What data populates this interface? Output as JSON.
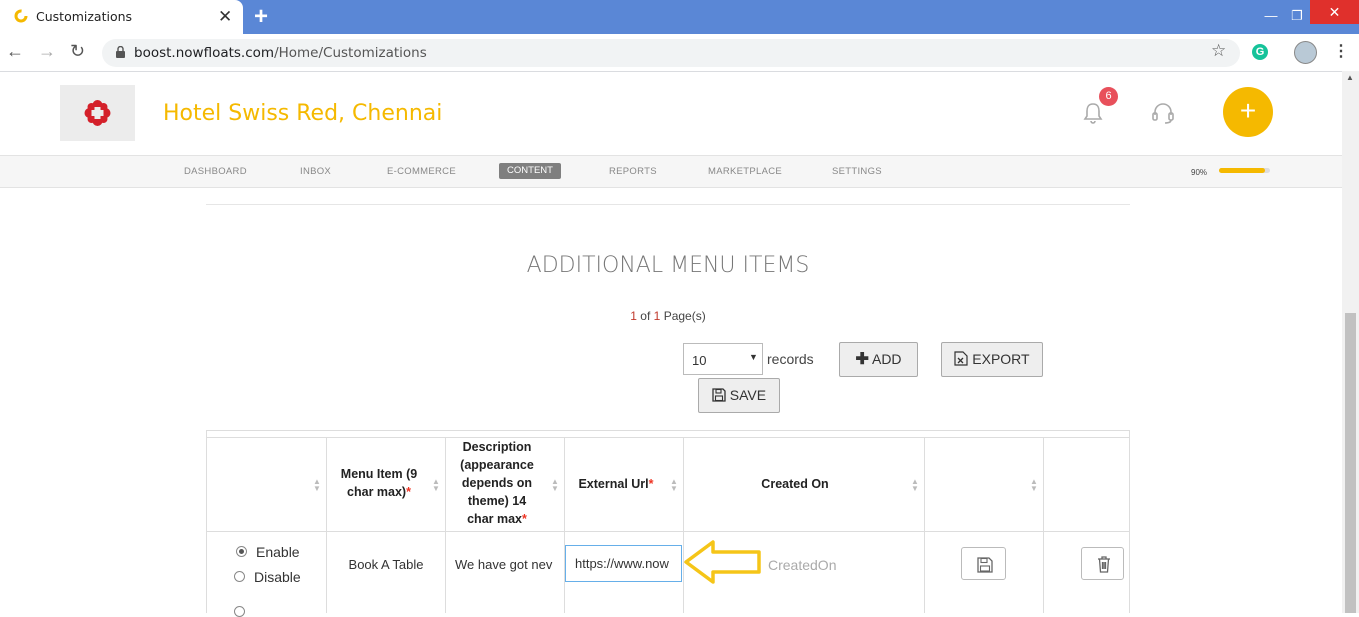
{
  "browser": {
    "tab_title": "Customizations",
    "tab_close": "✕",
    "new_tab": "+",
    "minimize": "—",
    "restore": "❐",
    "close": "✕",
    "url_host": "boost.nowfloats.com",
    "url_path": "/Home/Customizations",
    "grammarly_letter": "G"
  },
  "header": {
    "hotel_name": "Hotel Swiss Red, Chennai",
    "notification_count": "6",
    "fab_label": "+"
  },
  "nav": {
    "items": [
      "DASHBOARD",
      "INBOX",
      "E-COMMERCE",
      "CONTENT",
      "REPORTS",
      "MARKETPLACE",
      "SETTINGS"
    ],
    "active": "CONTENT",
    "progress_label": "90%",
    "progress_fraction": 0.9
  },
  "section": {
    "title": "ADDITIONAL MENU ITEMS",
    "pager_current": "1",
    "pager_of": "of",
    "pager_total": "1",
    "pager_suffix": "Page(s)",
    "records_value": "10",
    "records_label": "records",
    "add_label": "ADD",
    "export_label": "EXPORT",
    "save_label": "SAVE"
  },
  "table": {
    "headers": {
      "menu_item": [
        "Menu Item (9",
        "char max)"
      ],
      "description": [
        "Description",
        "(appearance",
        "depends on",
        "theme) 14",
        "char max"
      ],
      "external_url": "External Url",
      "created_on": "Created On",
      "required_mark": "*"
    },
    "row": {
      "enable_label": "Enable",
      "disable_label": "Disable",
      "status": "Enable",
      "menu_item": "Book A Table",
      "description": "We have got nev",
      "external_url": "https://www.now",
      "created_on_placeholder": "CreatedOn"
    }
  },
  "colors": {
    "brand": "#f5b900",
    "tab_bar": "#5a87d6",
    "badge": "#e8505b",
    "annotation_arrow": "#f5c518"
  }
}
